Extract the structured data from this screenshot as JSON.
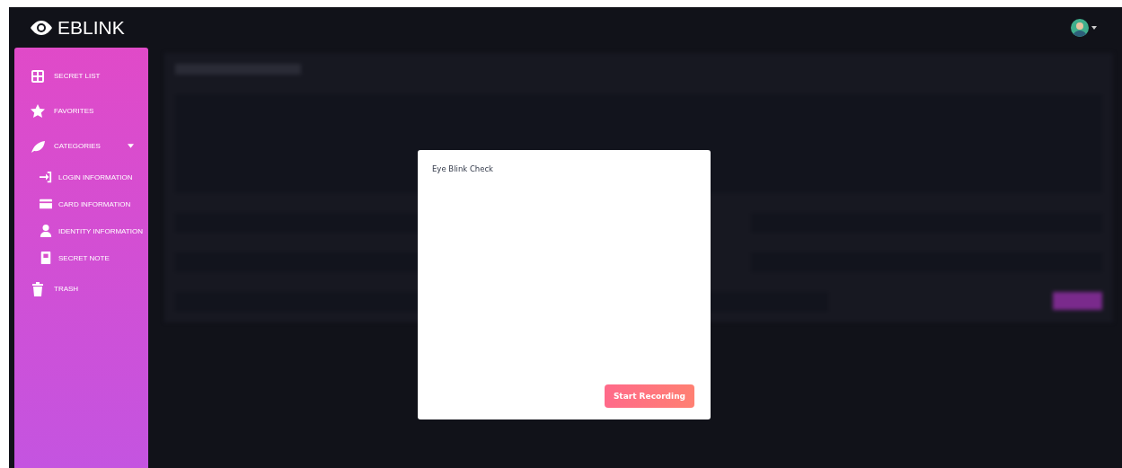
{
  "brand": {
    "name": "EBLINK"
  },
  "sidebar": {
    "items": [
      {
        "label": "SECRET LIST"
      },
      {
        "label": "FAVORITES"
      },
      {
        "label": "CATEGORIES",
        "expanded": true,
        "children": [
          {
            "label": "LOGIN INFORMATION"
          },
          {
            "label": "CARD INFORMATION"
          },
          {
            "label": "IDENTITY INFORMATION"
          },
          {
            "label": "SECRET NOTE"
          }
        ]
      },
      {
        "label": "TRASH"
      }
    ]
  },
  "dialog": {
    "title": "Eye Blink Check",
    "button": "Start Recording"
  }
}
